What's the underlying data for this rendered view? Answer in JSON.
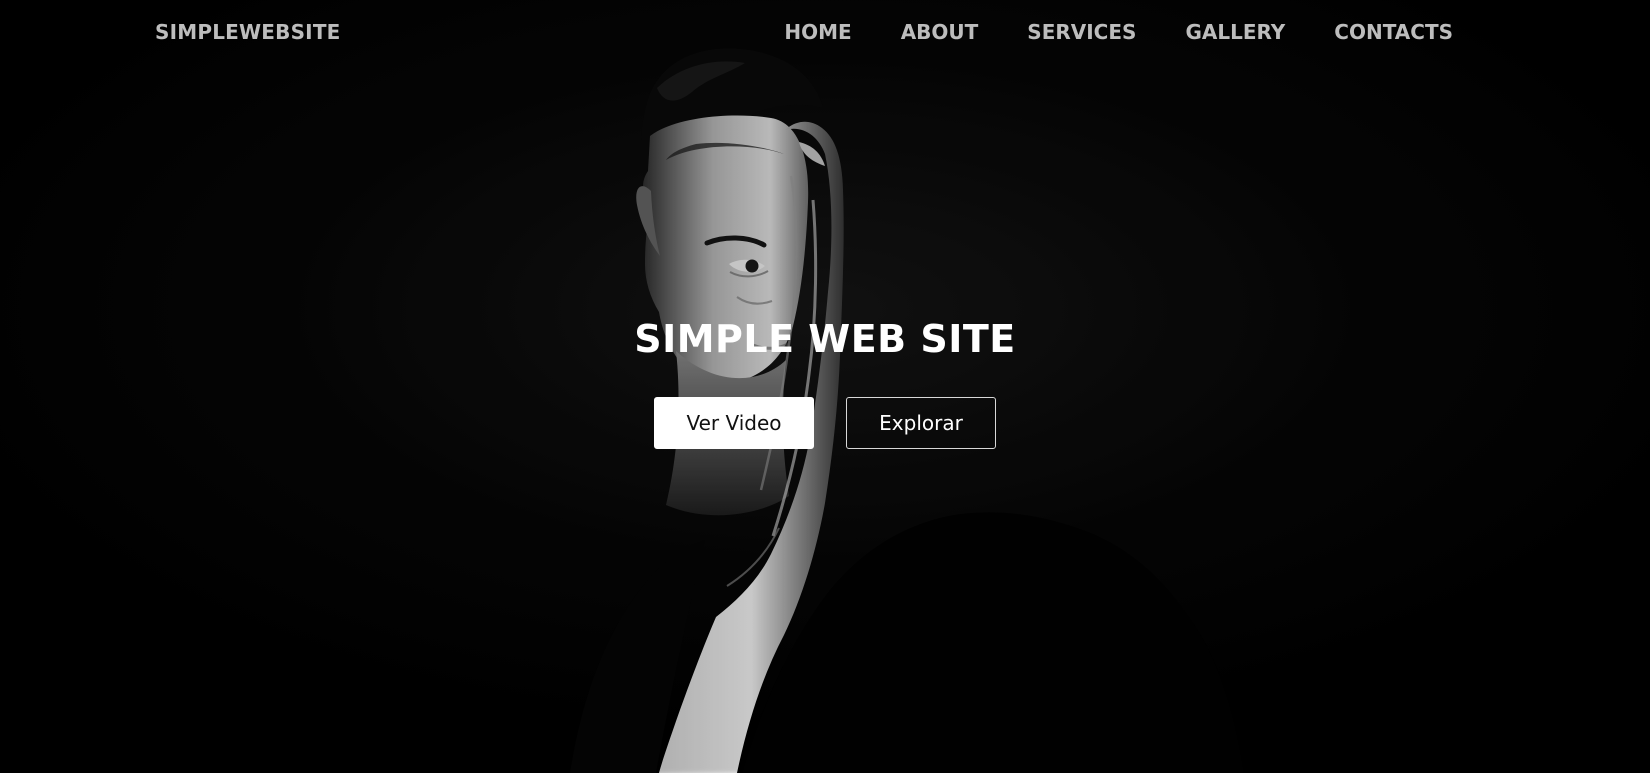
{
  "nav": {
    "brand": "SIMPLEWEBSITE",
    "links": [
      {
        "label": "HOME"
      },
      {
        "label": "ABOUT"
      },
      {
        "label": "SERVICES"
      },
      {
        "label": "GALLERY"
      },
      {
        "label": "CONTACTS"
      }
    ]
  },
  "hero": {
    "title": "SIMPLE WEB SITE",
    "primary_button": "Ver Video",
    "secondary_button": "Explorar"
  },
  "colors": {
    "background": "#000000",
    "nav_text": "#bdbdbd",
    "title_text": "#ffffff",
    "primary_button_bg": "#ffffff",
    "primary_button_text": "#111111",
    "secondary_button_border": "#d8d8d8"
  }
}
